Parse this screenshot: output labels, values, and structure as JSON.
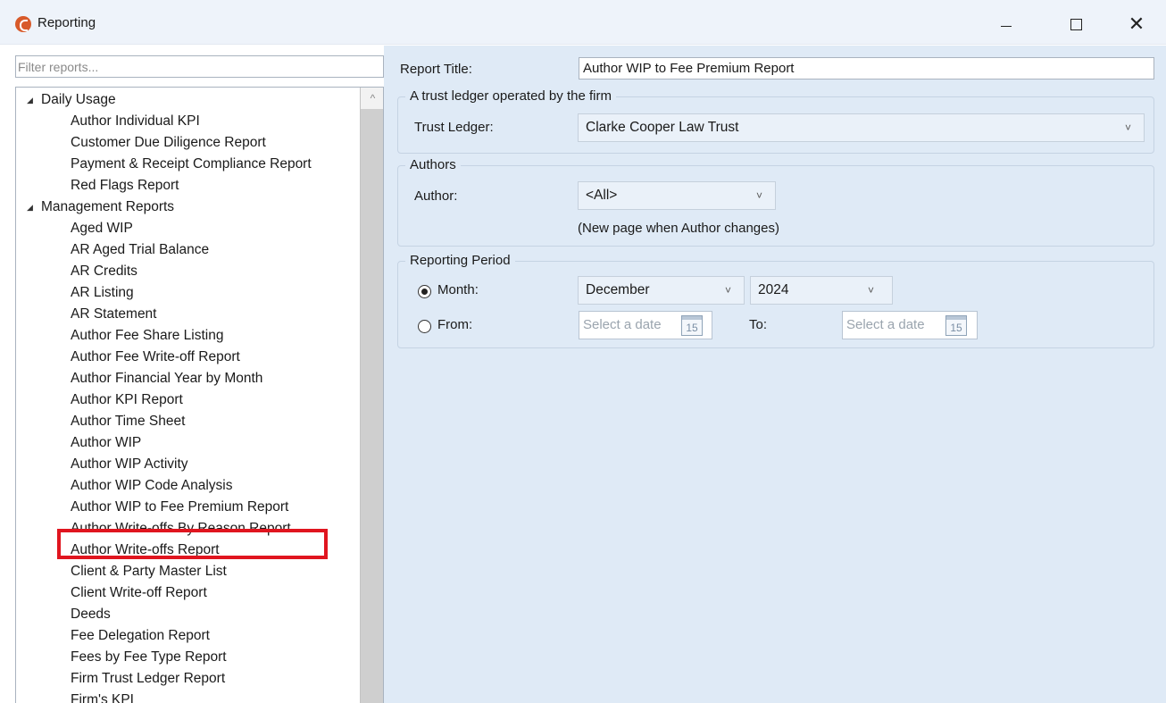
{
  "window": {
    "title": "Reporting",
    "minimize_glyph": "",
    "maximize_glyph": "",
    "close_glyph": "✕"
  },
  "sidebar": {
    "filter_placeholder": "Filter reports...",
    "groups": [
      {
        "label": "Daily Usage",
        "expanded": true,
        "items": [
          "Author Individual KPI",
          "Customer Due Diligence Report",
          "Payment & Receipt Compliance Report",
          "Red Flags Report"
        ]
      },
      {
        "label": "Management Reports",
        "expanded": true,
        "items": [
          "Aged WIP",
          "AR Aged Trial Balance",
          "AR Credits",
          "AR Listing",
          "AR Statement",
          "Author Fee Share Listing",
          "Author Fee Write-off Report",
          "Author Financial Year by Month",
          "Author KPI Report",
          "Author Time Sheet",
          "Author WIP",
          "Author WIP Activity",
          "Author WIP Code Analysis",
          "Author WIP to Fee Premium Report",
          "Author Write-offs By Reason Report",
          "Author Write-offs Report",
          "Client & Party Master List",
          "Client Write-off Report",
          "Deeds",
          "Fee Delegation Report",
          "Fees by Fee Type Report",
          "Firm Trust Ledger Report",
          "Firm's KPI"
        ]
      }
    ],
    "selected_item": "Author WIP to Fee Premium Report",
    "expander_glyph": "◢",
    "scroll_up_glyph": "^"
  },
  "form": {
    "report_title_label": "Report Title:",
    "report_title_value": "Author WIP to Fee Premium Report",
    "trust_group": {
      "legend": "A trust ledger operated by the firm",
      "label": "Trust Ledger:",
      "value": "Clarke Cooper Law Trust"
    },
    "authors_group": {
      "legend": "Authors",
      "label": "Author:",
      "value": "<All>",
      "note": "(New page when Author changes)"
    },
    "period_group": {
      "legend": "Reporting Period",
      "month_label": "Month:",
      "month_value": "December",
      "year_value": "2024",
      "from_label": "From:",
      "to_label": "To:",
      "date_placeholder": "Select a date",
      "calendar_glyph": "15",
      "selected_option": "month"
    },
    "chevron_glyph": "˅"
  },
  "colors": {
    "highlight_border": "#e0151f",
    "panel_background": "#dfeaf6",
    "app_icon": "#d85a2a"
  }
}
